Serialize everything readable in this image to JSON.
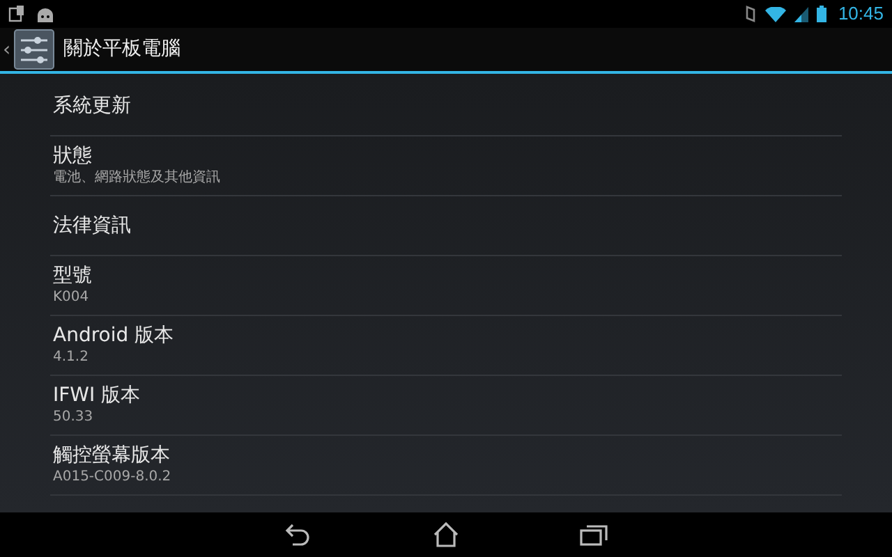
{
  "status_bar": {
    "time": "10:45"
  },
  "action_bar": {
    "back": "‹",
    "title": "關於平板電腦"
  },
  "items": [
    {
      "title": "系統更新"
    },
    {
      "title": "狀態",
      "summary": "電池、網路狀態及其他資訊"
    },
    {
      "title": "法律資訊"
    },
    {
      "title": "型號",
      "summary": "K004"
    },
    {
      "title": "Android 版本",
      "summary": "4.1.2"
    },
    {
      "title": "IFWI 版本",
      "summary": "50.33"
    },
    {
      "title": "觸控螢幕版本",
      "summary": "A015-C009-8.0.2"
    }
  ]
}
